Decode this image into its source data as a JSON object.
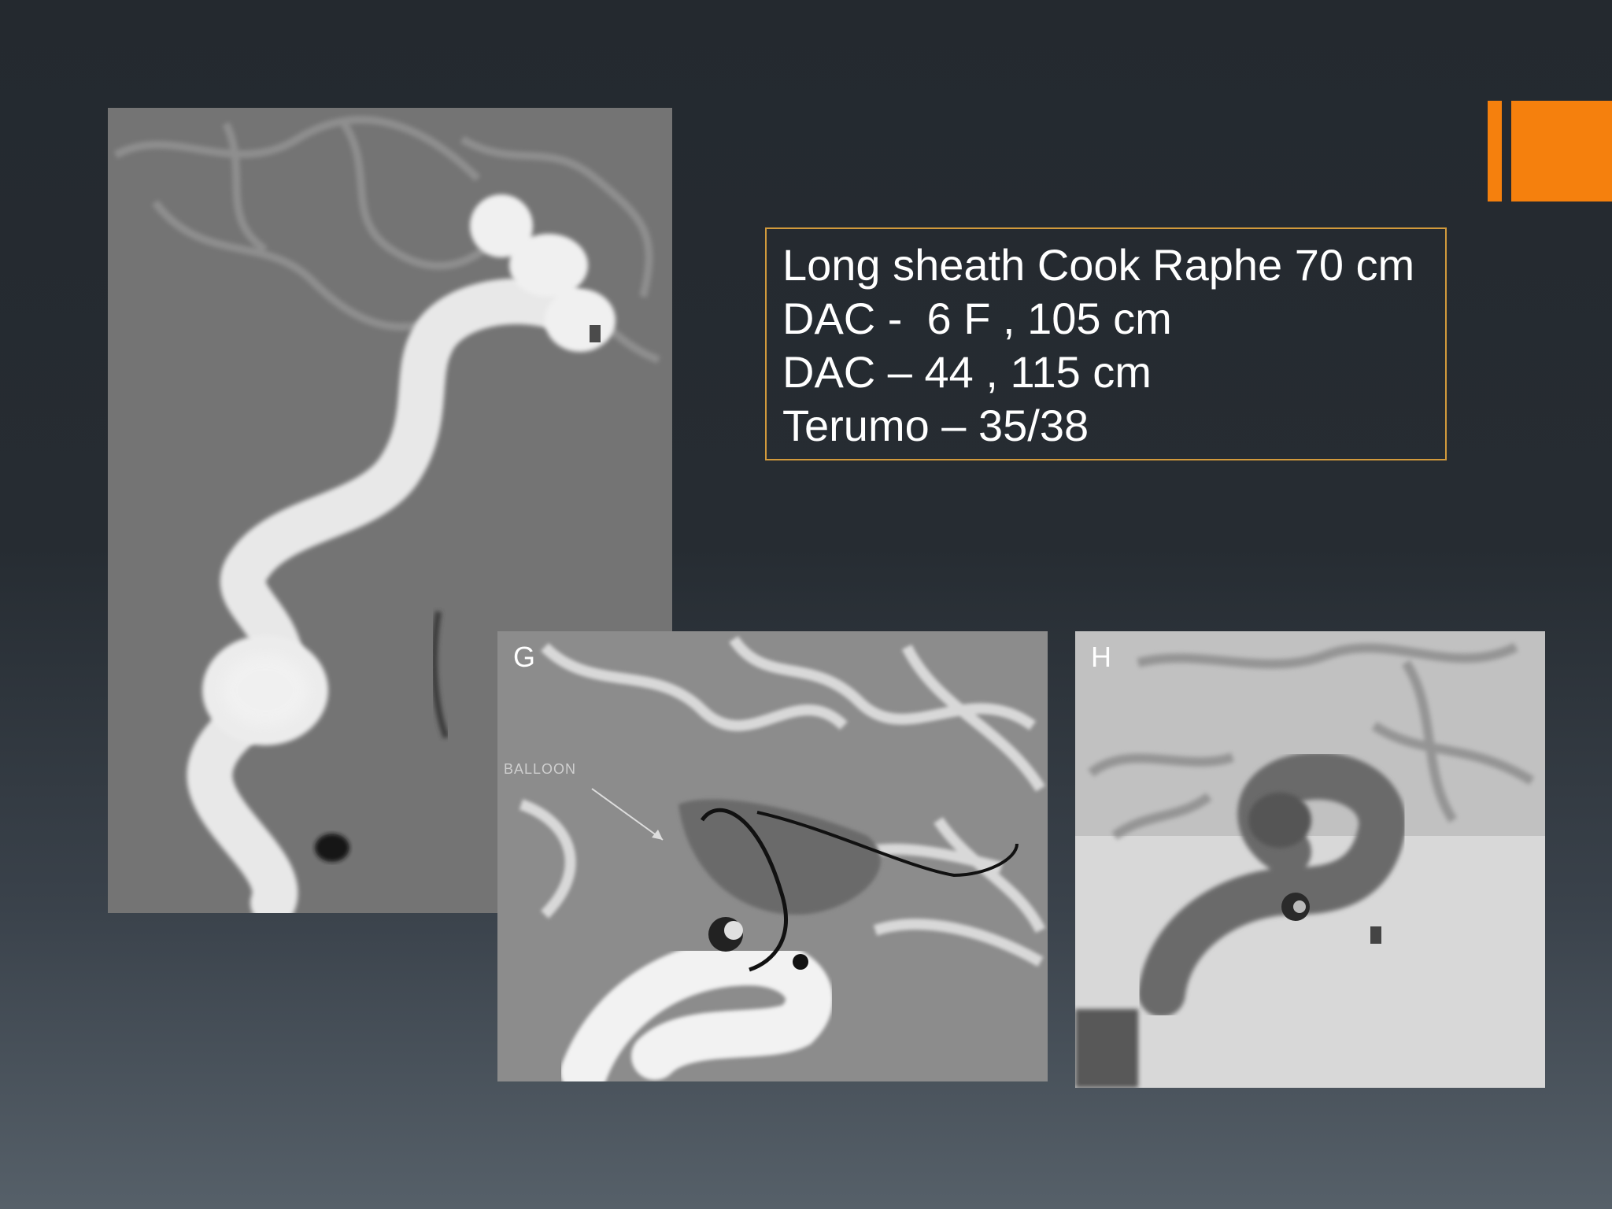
{
  "slide": {
    "text_box": {
      "lines": [
        "Long sheath Cook Raphe 70 cm",
        "DAC -  6 F , 105 cm",
        "DAC – 44 , 115 cm",
        "Terumo – 35/38"
      ]
    },
    "panels": {
      "g": {
        "label": "G",
        "annotation": "BALLOON"
      },
      "h": {
        "label": "H"
      }
    },
    "colors": {
      "accent": "#f5800d",
      "box_border": "#d29a3c",
      "text": "#ffffff"
    }
  }
}
